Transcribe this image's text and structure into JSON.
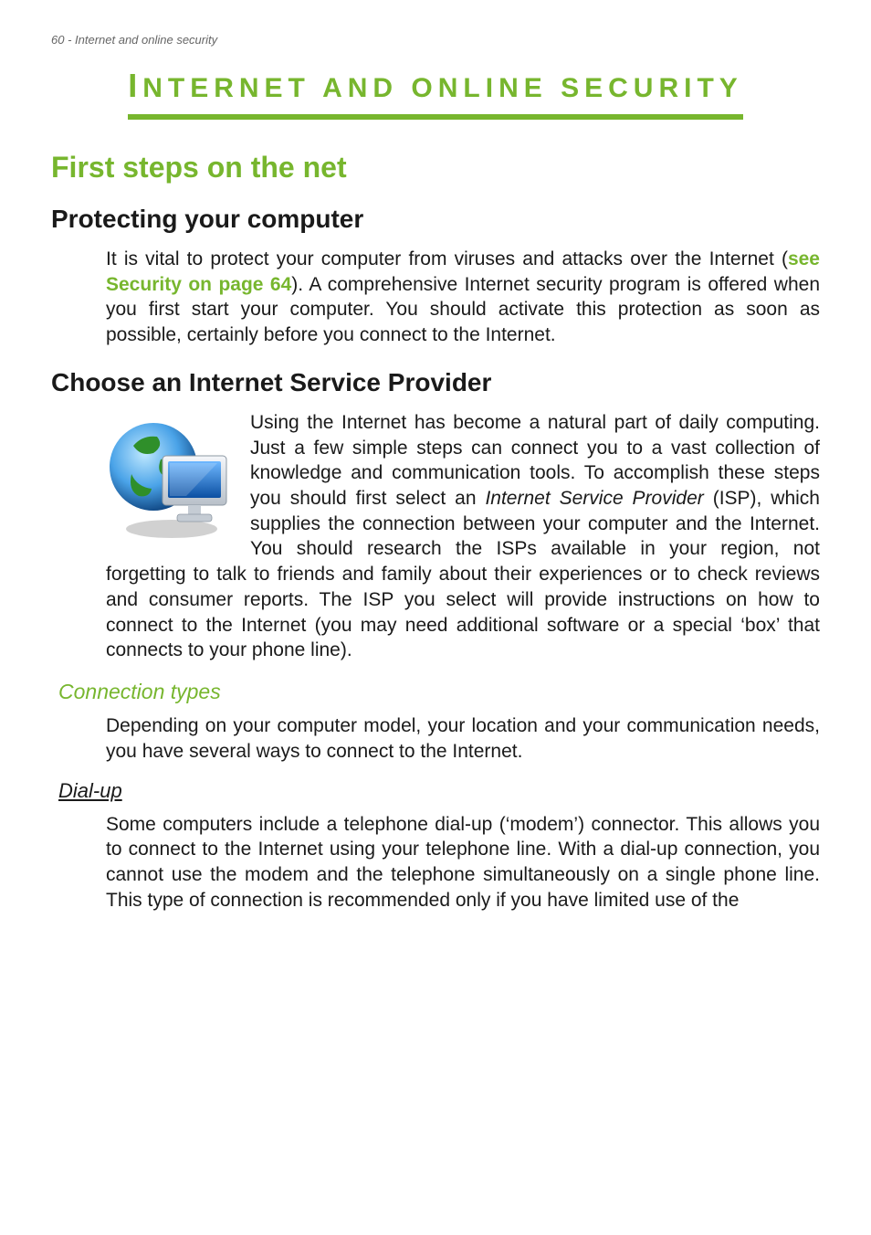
{
  "running_head": "60 - Internet and online security",
  "main_title_first": "I",
  "main_title_rest": "NTERNET AND ONLINE SECURITY",
  "h1_first_steps": "First steps on the net",
  "h2_protecting": "Protecting your computer",
  "p_protect_a": "It is vital to protect your computer from viruses and attacks over the Internet (",
  "link_security": "see Security on page 64",
  "p_protect_b": "). A comprehensive Internet security program is offered when you first start your computer. You should activate this protection as soon as possible, certainly before you connect to the Internet.",
  "h2_choose_isp": "Choose an Internet Service Provider",
  "p_isp_a": "Using the Internet has become a natural part of daily computing. Just a few simple steps can connect you to a vast collection of knowledge and communication tools. To accomplish these steps you should first select an ",
  "isp_em": "Internet Service Provider",
  "p_isp_b": " (ISP), which supplies the connection between your computer and the Internet. You should research the ISPs available in your region, not forgetting to talk to friends and family about their experiences or to check reviews and consumer reports. The ISP you select will provide instructions on how to connect to the Internet (you may need additional software or a special ‘box’ that connects to your phone line).",
  "h3_conn_types": "Connection types",
  "p_conn_types": "Depending on your computer model, your location and your communication needs, you have several ways to connect to the Internet.",
  "h4_dialup": "Dial-up",
  "p_dialup": "Some computers include a telephone dial-up (‘modem’) connector. This allows you to connect to the Internet using your telephone line. With a dial-up connection, you cannot use the modem and the telephone simultaneously on a single phone line. This type of connection is recommended only if you have limited use of the"
}
